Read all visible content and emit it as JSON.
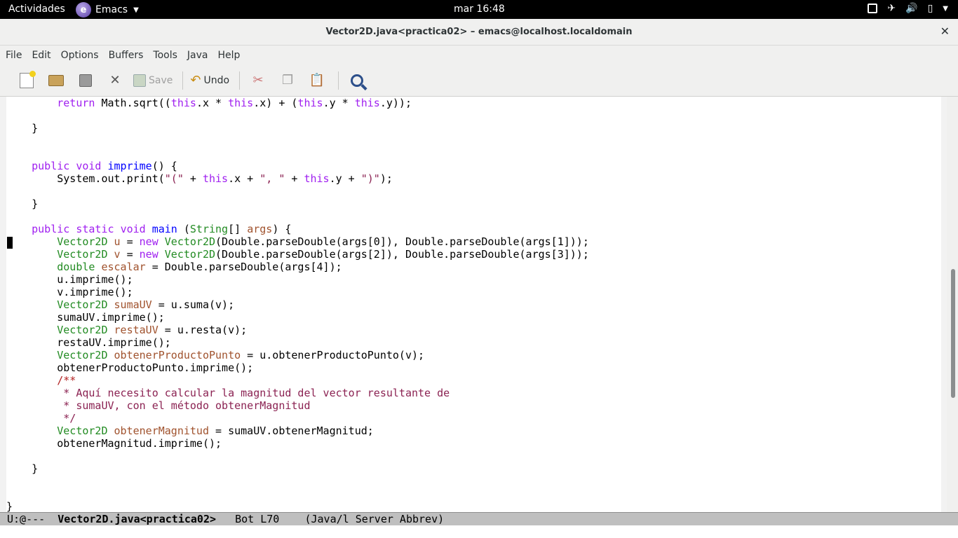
{
  "topbar": {
    "activities": "Actividades",
    "app_name": "Emacs",
    "clock": "mar 16:48"
  },
  "window": {
    "title": "Vector2D.java<practica02> – emacs@localhost.localdomain",
    "close": "✕"
  },
  "menubar": {
    "items": [
      "File",
      "Edit",
      "Options",
      "Buffers",
      "Tools",
      "Java",
      "Help"
    ]
  },
  "toolbar": {
    "save_label": "Save",
    "undo_label": "Undo"
  },
  "modeline": {
    "flags": "U:@---",
    "buffer": "Vector2D.java<practica02>",
    "position": "Bot L70",
    "modes": "(Java/l Server Abbrev)"
  },
  "code_lines": [
    [
      [
        "",
        "        "
      ],
      [
        "kw",
        "return"
      ],
      [
        "",
        " Math.sqrt(("
      ],
      [
        "kw",
        "this"
      ],
      [
        "",
        ".x * "
      ],
      [
        "kw",
        "this"
      ],
      [
        "",
        ".x) + ("
      ],
      [
        "kw",
        "this"
      ],
      [
        "",
        ".y * "
      ],
      [
        "kw",
        "this"
      ],
      [
        "",
        ".y));"
      ]
    ],
    [],
    [
      [
        "",
        "    }"
      ]
    ],
    [],
    [],
    [
      [
        "",
        "    "
      ],
      [
        "kw",
        "public"
      ],
      [
        "",
        " "
      ],
      [
        "kw",
        "void"
      ],
      [
        "",
        " "
      ],
      [
        "fn",
        "imprime"
      ],
      [
        "",
        "() {"
      ]
    ],
    [
      [
        "",
        "        System.out.print("
      ],
      [
        "str",
        "\"(\""
      ],
      [
        "",
        " + "
      ],
      [
        "kw",
        "this"
      ],
      [
        "",
        ".x + "
      ],
      [
        "str",
        "\", \""
      ],
      [
        "",
        " + "
      ],
      [
        "kw",
        "this"
      ],
      [
        "",
        ".y + "
      ],
      [
        "str",
        "\")\""
      ],
      [
        "",
        ");"
      ]
    ],
    [],
    [
      [
        "",
        "    }"
      ]
    ],
    [],
    [
      [
        "",
        "    "
      ],
      [
        "kw",
        "public"
      ],
      [
        "",
        " "
      ],
      [
        "kw",
        "static"
      ],
      [
        "",
        " "
      ],
      [
        "kw",
        "void"
      ],
      [
        "",
        " "
      ],
      [
        "fn",
        "main"
      ],
      [
        "",
        " ("
      ],
      [
        "ty",
        "String"
      ],
      [
        "",
        "[] "
      ],
      [
        "var",
        "args"
      ],
      [
        "",
        ") {"
      ]
    ],
    [
      [
        "",
        "        "
      ],
      [
        "ty",
        "Vector2D"
      ],
      [
        "",
        " "
      ],
      [
        "var",
        "u"
      ],
      [
        "",
        " = "
      ],
      [
        "kw",
        "new"
      ],
      [
        "",
        " "
      ],
      [
        "ty",
        "Vector2D"
      ],
      [
        "",
        "(Double.parseDouble(args[0]), Double.parseDouble(args[1]));"
      ]
    ],
    [
      [
        "",
        "        "
      ],
      [
        "ty",
        "Vector2D"
      ],
      [
        "",
        " "
      ],
      [
        "var",
        "v"
      ],
      [
        "",
        " = "
      ],
      [
        "kw",
        "new"
      ],
      [
        "",
        " "
      ],
      [
        "ty",
        "Vector2D"
      ],
      [
        "",
        "(Double.parseDouble(args[2]), Double.parseDouble(args[3]));"
      ]
    ],
    [
      [
        "",
        "        "
      ],
      [
        "ty",
        "double"
      ],
      [
        "",
        " "
      ],
      [
        "var",
        "escalar"
      ],
      [
        "",
        " = Double.parseDouble(args[4]);"
      ]
    ],
    [
      [
        "",
        "        u.imprime();"
      ]
    ],
    [
      [
        "",
        "        v.imprime();"
      ]
    ],
    [
      [
        "",
        "        "
      ],
      [
        "ty",
        "Vector2D"
      ],
      [
        "",
        " "
      ],
      [
        "var",
        "sumaUV"
      ],
      [
        "",
        " = u.suma(v);"
      ]
    ],
    [
      [
        "",
        "        sumaUV.imprime();"
      ]
    ],
    [
      [
        "",
        "        "
      ],
      [
        "ty",
        "Vector2D"
      ],
      [
        "",
        " "
      ],
      [
        "var",
        "restaUV"
      ],
      [
        "",
        " = u.resta(v);"
      ]
    ],
    [
      [
        "",
        "        restaUV.imprime();"
      ]
    ],
    [
      [
        "",
        "        "
      ],
      [
        "ty",
        "Vector2D"
      ],
      [
        "",
        " "
      ],
      [
        "var",
        "obtenerProductoPunto"
      ],
      [
        "",
        " = u.obtenerProductoPunto(v);"
      ]
    ],
    [
      [
        "",
        "        obtenerProductoPunto.imprime();"
      ]
    ],
    [
      [
        "",
        "        "
      ],
      [
        "cm",
        "/**"
      ]
    ],
    [
      [
        "",
        "         "
      ],
      [
        "str",
        "* Aquí necesito calcular la magnitud del vector resultante de"
      ]
    ],
    [
      [
        "",
        "         "
      ],
      [
        "str",
        "* sumaUV, con el método obtenerMagnitud"
      ]
    ],
    [
      [
        "",
        "         "
      ],
      [
        "str",
        "*/"
      ]
    ],
    [
      [
        "",
        "        "
      ],
      [
        "ty",
        "Vector2D"
      ],
      [
        "",
        " "
      ],
      [
        "var",
        "obtenerMagnitud"
      ],
      [
        "",
        " = sumaUV.obtenerMagnitud;"
      ]
    ],
    [
      [
        "",
        "        obtenerMagnitud.imprime();"
      ]
    ],
    [],
    [
      [
        "",
        "    }"
      ]
    ],
    [],
    [],
    [
      [
        "",
        "}"
      ]
    ]
  ]
}
